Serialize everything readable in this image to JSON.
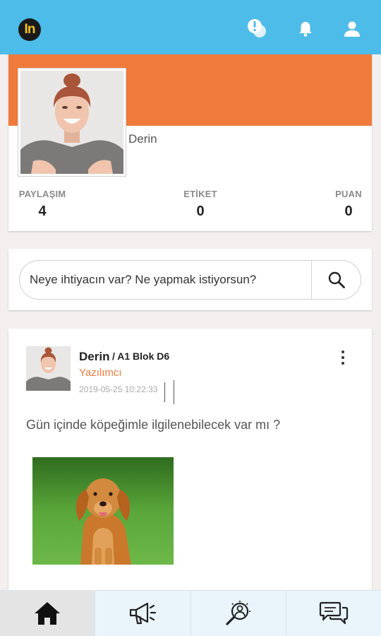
{
  "app": {
    "logo_text": "In"
  },
  "topbar": {
    "icons": [
      "chat-alert-icon",
      "bell-icon",
      "user-icon"
    ]
  },
  "profile": {
    "name": "Derin",
    "stats": [
      {
        "label": "PAYLAŞIM",
        "value": "4"
      },
      {
        "label": "ETİKET",
        "value": "0"
      },
      {
        "label": "PUAN",
        "value": "0"
      }
    ]
  },
  "search": {
    "placeholder": "Neye ihtiyacın var? Ne yapmak istiyorsun?"
  },
  "post": {
    "author": "Derin",
    "location": "/ A1 Blok D6",
    "role": "Yazılımcı",
    "date": "2019-05-25 10:22:33",
    "text": "Gün içinde köpeğimle ilgilenebilecek var mı ?"
  },
  "bottom_nav": {
    "items": [
      "home-icon",
      "megaphone-icon",
      "search-people-icon",
      "messages-icon"
    ],
    "active": "home-icon"
  },
  "colors": {
    "header": "#4dbce9",
    "accent": "#f07a3c",
    "logo_bg": "#1a1a1a",
    "logo_text": "#f6c21b"
  }
}
